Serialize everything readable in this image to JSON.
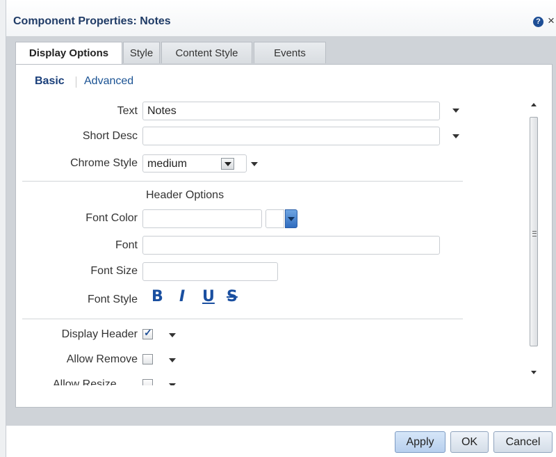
{
  "dialog": {
    "title": "Component Properties: Notes",
    "help_icon": "?",
    "close_icon": "×"
  },
  "tabs": [
    {
      "label": "Display Options",
      "active": true
    },
    {
      "label": "Style",
      "active": false
    },
    {
      "label": "Content Style",
      "active": false
    },
    {
      "label": "Events",
      "active": false
    }
  ],
  "subtabs": [
    {
      "label": "Basic",
      "active": true
    },
    {
      "label": "Advanced",
      "active": false
    }
  ],
  "basic": {
    "text_label": "Text",
    "text_value": "Notes",
    "short_desc_label": "Short Desc",
    "short_desc_value": "",
    "chrome_style_label": "Chrome Style",
    "chrome_style_value": "medium"
  },
  "header_options": {
    "section_title": "Header Options",
    "font_color_label": "Font Color",
    "font_color_value": "",
    "font_label": "Font",
    "font_value": "",
    "font_size_label": "Font Size",
    "font_size_value": "",
    "font_style_label": "Font Style",
    "font_style_buttons": {
      "bold": "B",
      "italic": "I",
      "underline": "U",
      "strike": "S"
    }
  },
  "checkboxes": {
    "display_header_label": "Display Header",
    "display_header_checked": true,
    "allow_remove_label": "Allow Remove",
    "allow_remove_checked": false,
    "allow_resize_label": "Allow Resize",
    "allow_resize_checked": false
  },
  "footer": {
    "apply": "Apply",
    "ok": "OK",
    "cancel": "Cancel"
  },
  "colors": {
    "accent": "#1a4fa0",
    "title": "#1f3b66",
    "panel_bg": "#cfd3d8"
  }
}
